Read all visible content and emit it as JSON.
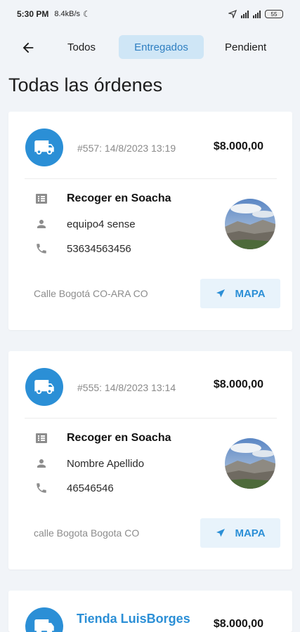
{
  "status_bar": {
    "time": "5:30 PM",
    "speed": "8.4kB/s",
    "battery": "55"
  },
  "nav": {
    "tabs": [
      {
        "label": "Todos"
      },
      {
        "label": "Entregados"
      },
      {
        "label": "Pendient"
      }
    ],
    "active_tab": "Entregados"
  },
  "page_title": "Todas las órdenes",
  "orders": [
    {
      "meta": "#557: 14/8/2023 13:19",
      "price": "$8.000,00",
      "title": "Recoger en Soacha",
      "customer": "equipo4 sense",
      "phone": "53634563456",
      "address": "Calle Bogotá CO-ARA CO",
      "map_label": "MAPA"
    },
    {
      "meta": "#555: 14/8/2023 13:14",
      "price": "$8.000,00",
      "title": "Recoger en Soacha",
      "customer": "Nombre Apellido",
      "phone": "46546546",
      "address": "calle Bogota Bogota CO",
      "map_label": "MAPA"
    },
    {
      "store": "Tienda LuisBorges",
      "price": "$8.000,00"
    }
  ],
  "colors": {
    "accent": "#2b8fd6",
    "active_tab_bg": "#cfe6f6",
    "map_button_bg": "#e8f3fb",
    "background": "#f1f4f8"
  },
  "icons": {
    "back": "arrow-left-icon",
    "truck": "truck-icon",
    "receipt": "list-icon",
    "person": "person-icon",
    "phone": "phone-icon",
    "navigate": "navigation-arrow-icon"
  }
}
